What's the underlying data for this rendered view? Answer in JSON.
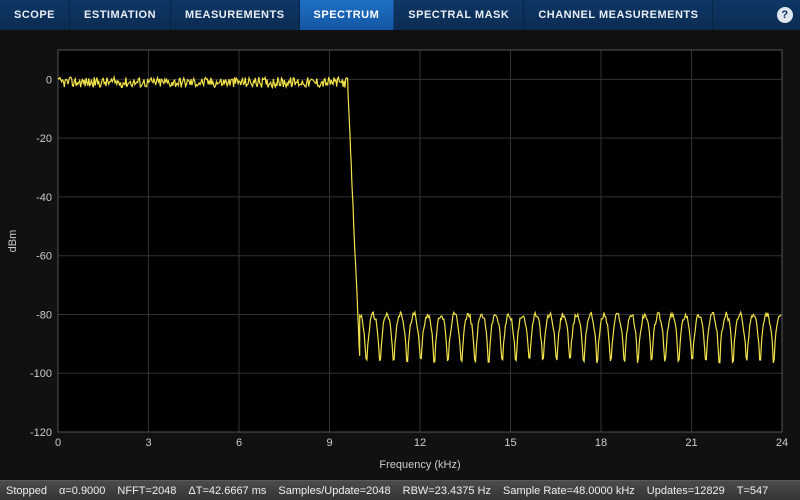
{
  "tabs": {
    "items": [
      {
        "label": "SCOPE",
        "active": false
      },
      {
        "label": "ESTIMATION",
        "active": false
      },
      {
        "label": "MEASUREMENTS",
        "active": false
      },
      {
        "label": "SPECTRUM",
        "active": true
      },
      {
        "label": "SPECTRAL MASK",
        "active": false
      },
      {
        "label": "CHANNEL MEASUREMENTS",
        "active": false
      }
    ],
    "help": "?"
  },
  "status": {
    "state": "Stopped",
    "alpha": "α=0.9000",
    "nfft": "NFFT=2048",
    "dt": "ΔT=42.6667 ms",
    "spu": "Samples/Update=2048",
    "rbw": "RBW=23.4375 Hz",
    "srate": "Sample Rate=48.0000 kHz",
    "updates": "Updates=12829",
    "t": "T=547"
  },
  "chart_data": {
    "type": "line",
    "title": "",
    "xlabel": "Frequency (kHz)",
    "ylabel": "dBm",
    "xlim": [
      0,
      24
    ],
    "ylim": [
      -120,
      10
    ],
    "xticks": [
      0,
      3,
      6,
      9,
      12,
      15,
      18,
      21,
      24
    ],
    "yticks": [
      -120,
      -100,
      -80,
      -60,
      -40,
      -20,
      0
    ],
    "xtick_labels": [
      "0",
      "3",
      "6",
      "9",
      "12",
      "15",
      "18",
      "21",
      "24"
    ],
    "ytick_labels": [
      "-120",
      "-100",
      "-80",
      "-60",
      "-40",
      "-20",
      "0"
    ],
    "series": [
      {
        "name": "spectrum",
        "color": "#f2e24a",
        "passband": {
          "x_start": 0,
          "x_end": 9.6,
          "mean": -1.0,
          "noise_amp": 1.8
        },
        "transition": {
          "x_start": 9.6,
          "x_end": 10.0,
          "y_to": -95
        },
        "stopband": {
          "x_start": 10.0,
          "x_end": 24.0,
          "lobe_peak": -80,
          "lobe_trough": -103,
          "lobe_spacing_khz": 0.45,
          "noise_amp": 2.0
        }
      }
    ]
  }
}
